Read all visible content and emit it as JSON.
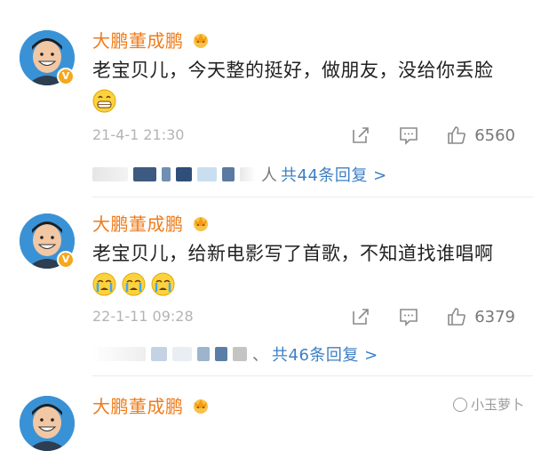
{
  "comments": [
    {
      "username": "大鹏董成鹏",
      "text": "老宝贝儿，今天整的挺好，做朋友，没给你丢脸",
      "emojis": [
        "grin-emoji"
      ],
      "time": "21-4-1 21:30",
      "like_count": "6560",
      "reply_prefix": "人",
      "reply_link": "共44条回复 >"
    },
    {
      "username": "大鹏董成鹏",
      "text": "老宝贝儿，给新电影写了首歌，不知道找谁唱啊",
      "emojis": [
        "crying-emoji",
        "crying-emoji",
        "crying-emoji"
      ],
      "time": "22-1-11 09:28",
      "like_count": "6379",
      "reply_prefix": "、",
      "reply_link": "共46条回复 >"
    },
    {
      "username": "大鹏董成鹏"
    }
  ],
  "watermark": "小玉萝卜",
  "colors": {
    "username": "#ef7b1a",
    "link": "#3c7fc4",
    "meta": "#b4b4b4",
    "avatar_bg": "#3a92d6"
  }
}
